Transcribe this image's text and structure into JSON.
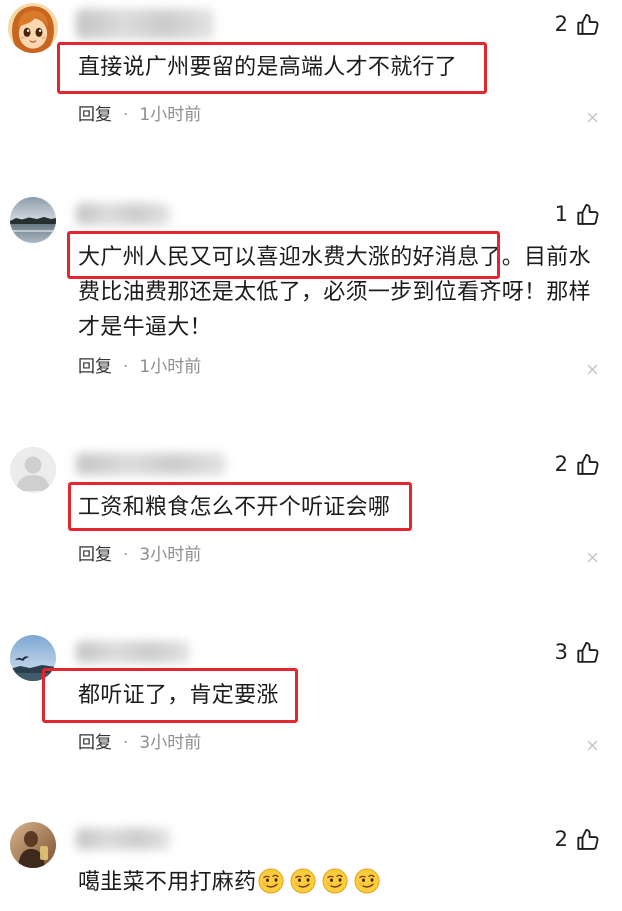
{
  "labels": {
    "reply": "回复",
    "separator": "·"
  },
  "comments": [
    {
      "avatar": "cartoon-girl-avatar",
      "likes": 2,
      "lines": [
        "直接说广州要留的是高端人才不就行了"
      ],
      "highlighted": true,
      "time": "1小时前"
    },
    {
      "avatar": "lake-landscape-avatar",
      "likes": 1,
      "lines": [
        "大广州人民又可以喜迎水费大涨的好消息了。目前水",
        "费比油费那还是太低了，必须一步到位看齐呀！那样",
        "才是牛逼大！"
      ],
      "highlighted": true,
      "time": "1小时前"
    },
    {
      "avatar": "default-user-avatar",
      "likes": 2,
      "lines": [
        "工资和粮食怎么不开个听证会哪"
      ],
      "highlighted": true,
      "time": "3小时前"
    },
    {
      "avatar": "sky-bird-avatar",
      "likes": 3,
      "lines": [
        "都听证了，肯定要涨"
      ],
      "highlighted": true,
      "time": "3小时前"
    },
    {
      "avatar": "warm-photo-avatar",
      "likes": 2,
      "lines": [
        "噶韭菜不用打麻药"
      ],
      "emojis": [
        "smirk-emoji",
        "smirk-emoji",
        "smirk-emoji",
        "smirk-emoji"
      ],
      "highlighted": false
    }
  ],
  "icons": {
    "like": "thumbs-up-icon",
    "dismiss": "close-icon"
  },
  "colors": {
    "highlight_box": "#e3262f",
    "text": "#1c1c1c",
    "meta": "#8e8e8e"
  }
}
